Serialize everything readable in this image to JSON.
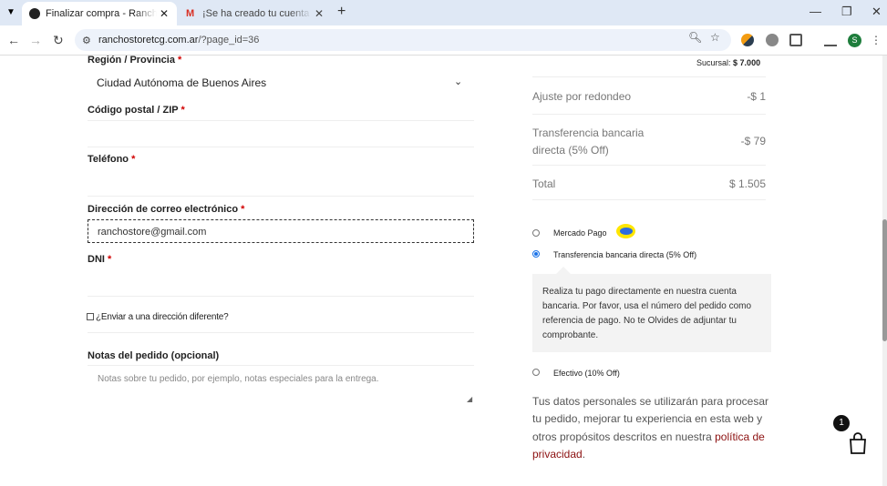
{
  "browser": {
    "tabs": [
      {
        "title": "Finalizar compra - Rancho Store",
        "active": true
      },
      {
        "title": "¡Se ha creado tu cuenta en Rancho Store!",
        "active": false
      }
    ],
    "url_domain": "ranchostoretcg.com.ar",
    "url_path": "/?page_id=36",
    "profile_initial": "S"
  },
  "form": {
    "region_label": "Región / Provincia",
    "region_value": "Ciudad Autónoma de Buenos Aires",
    "postal_label": "Código postal / ZIP",
    "phone_label": "Teléfono",
    "email_label": "Dirección de correo electrónico",
    "email_value": "ranchostore@gmail.com",
    "dni_label": "DNI",
    "required_mark": "*",
    "ship_different_label": "¿Enviar a una dirección diferente?",
    "notes_label": "Notas del pedido (opcional)",
    "notes_placeholder": "Notas sobre tu pedido, por ejemplo, notas especiales para la entrega."
  },
  "summary": {
    "sucursal_label": "Sucursal:",
    "sucursal_value": "$ 7.000",
    "rows": [
      {
        "label": "Ajuste por redondeo",
        "value": "-$ 1"
      },
      {
        "label": "Transferencia bancaria directa (5% Off)",
        "value": "-$ 79"
      },
      {
        "label": "Total",
        "value": "$ 1.505"
      }
    ]
  },
  "payment": {
    "methods": [
      {
        "label": "Mercado Pago",
        "checked": false
      },
      {
        "label": "Transferencia bancaria directa (5% Off)",
        "checked": true
      },
      {
        "label": "Efectivo (10% Off)",
        "checked": false
      }
    ],
    "transfer_description": "Realiza tu pago directamente en nuestra cuenta bancaria. Por favor, usa el número del pedido como referencia de pago. No te Olvides de adjuntar tu comprobante."
  },
  "privacy": {
    "text": "Tus datos personales se utilizarán para procesar tu pedido, mejorar tu experiencia en esta web y otros propósitos descritos en nuestra",
    "link": "política de privacidad",
    "end": "."
  },
  "cart": {
    "count": "1"
  },
  "colors": {
    "link": "#8c1010",
    "required": "#d10000",
    "tabbar": "#dfe8f5"
  }
}
